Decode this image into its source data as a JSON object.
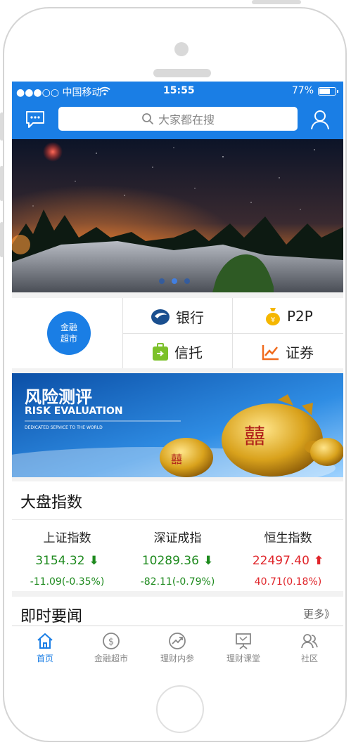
{
  "status_bar": {
    "carrier": "●●●○○ 中国移动",
    "time": "15:55",
    "battery": "77%",
    "battery_level": 0.77
  },
  "header": {
    "search_placeholder": "大家都在搜",
    "left_icon": "chat-icon",
    "right_icon": "user-icon"
  },
  "carousel": {
    "slide_count": 3,
    "active_index": 1
  },
  "categories": {
    "featured": {
      "line1": "金融",
      "line2": "超市"
    },
    "items": [
      {
        "label": "银行",
        "icon": "bank-icon",
        "color": "#1a4f8f"
      },
      {
        "label": "P2P",
        "icon": "money-bag-icon",
        "color": "#f5b700"
      },
      {
        "label": "信托",
        "icon": "trust-icon",
        "color": "#7cc12a"
      },
      {
        "label": "证券",
        "icon": "chart-icon",
        "color": "#f06b1d"
      }
    ]
  },
  "risk_banner": {
    "title": "风险测评",
    "subtitle": "RISK EVALUATION",
    "tagline": "DEDICATED SERVICE TO THE WORLD"
  },
  "market_index": {
    "title": "大盘指数",
    "indices": [
      {
        "name": "上证指数",
        "value": "3154.32",
        "change": "-11.09(-0.35%)",
        "direction": "down",
        "color": "#1e8a1e"
      },
      {
        "name": "深证成指",
        "value": "10289.36",
        "change": "-82.11(-0.79%)",
        "direction": "down",
        "color": "#1e8a1e"
      },
      {
        "name": "恒生指数",
        "value": "22497.40",
        "change": "40.71(0.18%)",
        "direction": "up",
        "color": "#e0262b"
      }
    ]
  },
  "news": {
    "title": "即时要闻",
    "more": "更多》"
  },
  "tabbar": {
    "items": [
      {
        "label": "首页",
        "icon": "home-icon",
        "active": true
      },
      {
        "label": "金融超市",
        "icon": "dollar-icon",
        "active": false
      },
      {
        "label": "理财内参",
        "icon": "trend-icon",
        "active": false
      },
      {
        "label": "理财课堂",
        "icon": "presentation-icon",
        "active": false
      },
      {
        "label": "社区",
        "icon": "community-icon",
        "active": false
      }
    ]
  },
  "colors": {
    "primary": "#1a7ee5",
    "down": "#1e8a1e",
    "up": "#e0262b"
  }
}
